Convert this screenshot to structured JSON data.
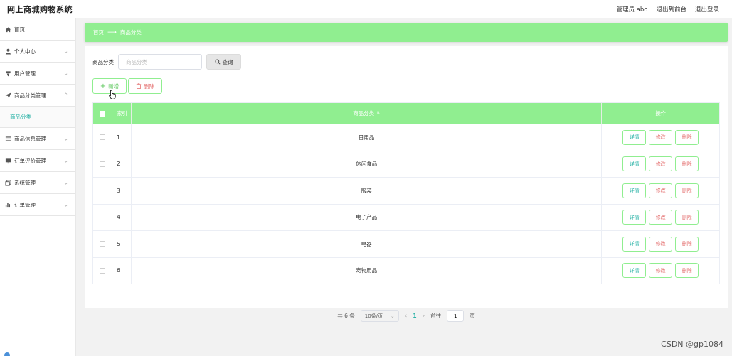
{
  "header": {
    "brand": "网上商城购物系统",
    "admin": "管理员 abo",
    "to_front": "退出到前台",
    "logout": "退出登录"
  },
  "sidebar": {
    "items": [
      {
        "label": "首页",
        "icon": "home-icon",
        "chevron": ""
      },
      {
        "label": "个人中心",
        "icon": "user-icon",
        "chevron": "⌄"
      },
      {
        "label": "用户管理",
        "icon": "users-icon",
        "chevron": "⌄"
      },
      {
        "label": "商品分类管理",
        "icon": "send-icon",
        "chevron": "⌃"
      },
      {
        "label": "商品信息管理",
        "icon": "list-icon",
        "chevron": "⌄"
      },
      {
        "label": "订单评价管理",
        "icon": "monitor-icon",
        "chevron": "⌄"
      },
      {
        "label": "系统管理",
        "icon": "copy-icon",
        "chevron": "⌄"
      },
      {
        "label": "订单管理",
        "icon": "chart-icon",
        "chevron": "⌄"
      }
    ],
    "active_sub": "商品分类"
  },
  "breadcrumb": {
    "home": "首页",
    "current": "商品分类"
  },
  "search": {
    "label": "商品分类",
    "placeholder": "商品分类",
    "button": "查询"
  },
  "actions": {
    "add": "新增",
    "delete": "删除"
  },
  "table": {
    "headers": {
      "index": "索引",
      "name": "商品分类",
      "ops": "操作"
    },
    "rows": [
      {
        "index": "1",
        "name": "日用品"
      },
      {
        "index": "2",
        "name": "休闲食品"
      },
      {
        "index": "3",
        "name": "服装"
      },
      {
        "index": "4",
        "name": "电子产品"
      },
      {
        "index": "5",
        "name": "电器"
      },
      {
        "index": "6",
        "name": "宠物用品"
      }
    ],
    "op_labels": {
      "detail": "详情",
      "edit": "修改",
      "remove": "删除"
    }
  },
  "pager": {
    "total": "共 6 条",
    "page_size": "10条/页",
    "current": "1",
    "goto_label": "前往",
    "goto_value": "1",
    "page_suffix": "页"
  },
  "watermark": "CSDN @gp1084",
  "colors": {
    "accent": "#90ee90",
    "teal": "#2bb3a7",
    "danger": "#e57373"
  }
}
